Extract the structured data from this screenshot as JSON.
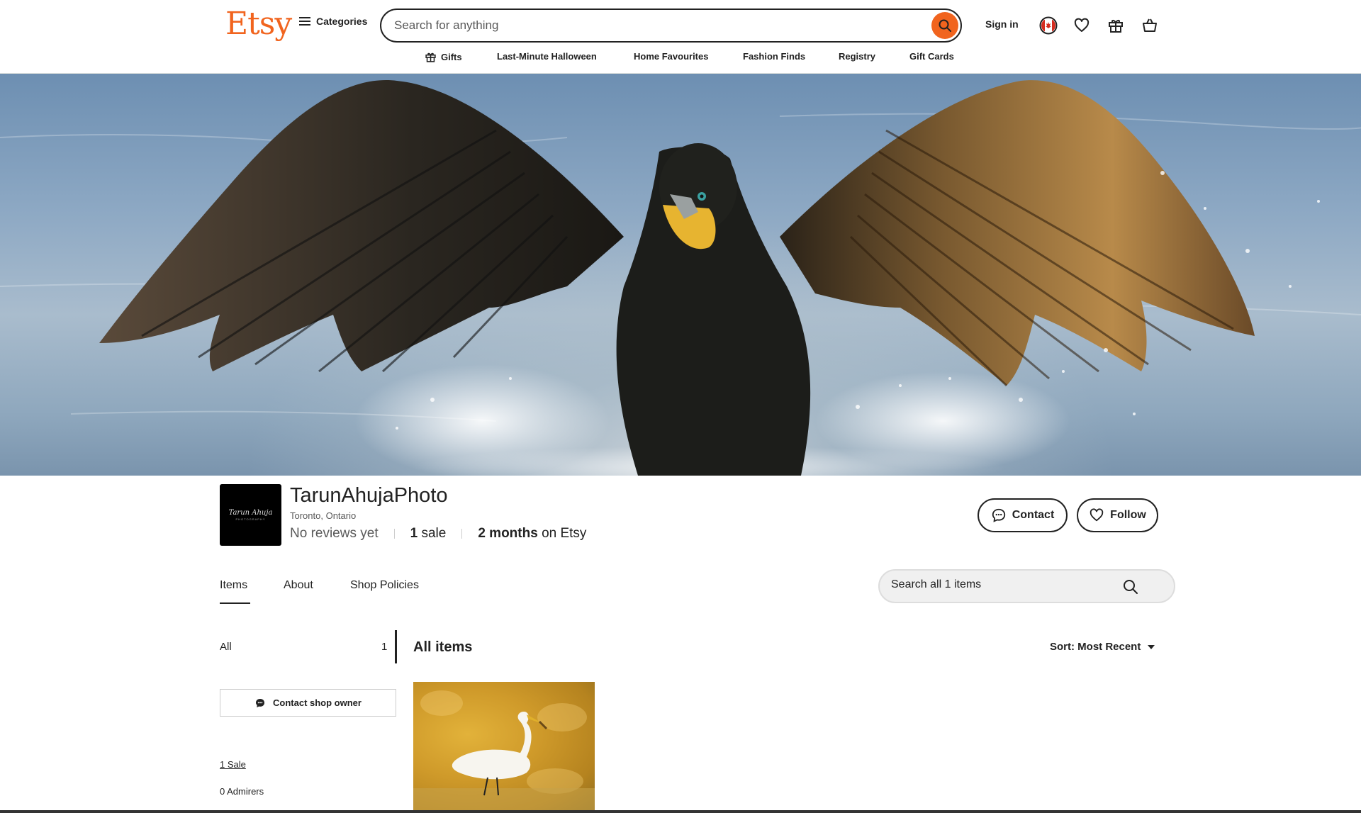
{
  "header": {
    "logo": "Etsy",
    "categories_label": "Categories",
    "search_placeholder": "Search for anything",
    "signin_label": "Sign in"
  },
  "nav": {
    "items": [
      {
        "label": "Gifts",
        "icon": "gift-icon"
      },
      {
        "label": "Last-Minute Halloween"
      },
      {
        "label": "Home Favourites"
      },
      {
        "label": "Fashion Finds"
      },
      {
        "label": "Registry"
      },
      {
        "label": "Gift Cards"
      }
    ]
  },
  "shop": {
    "logo_signature": "Tarun Ahuja",
    "logo_subtitle": "PHOTOGRAPHY",
    "name": "TarunAhujaPhoto",
    "location": "Toronto, Ontario",
    "reviews": "No reviews yet",
    "sales_count": "1",
    "sales_label": "sale",
    "tenure_value": "2 months",
    "tenure_label": "on Etsy",
    "contact_label": "Contact",
    "follow_label": "Follow"
  },
  "tabs": {
    "items": "Items",
    "about": "About",
    "policies": "Shop Policies",
    "search_placeholder": "Search all 1 items"
  },
  "sidebar": {
    "all_label": "All",
    "all_count": "1",
    "contact_owner_label": "Contact shop owner",
    "sales_link": "1 Sale",
    "admirers": "0 Admirers"
  },
  "main": {
    "title": "All items",
    "sort_label": "Sort: Most Recent"
  },
  "colors": {
    "brand": "#f1641e",
    "text": "#222222"
  }
}
